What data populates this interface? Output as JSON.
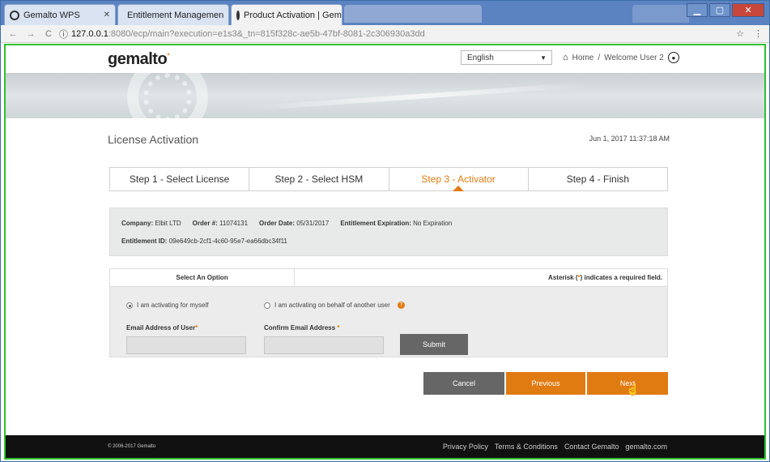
{
  "browser": {
    "tabs": [
      {
        "title": "Gemalto WPS"
      },
      {
        "title": "Entitlement Managemen"
      },
      {
        "title": "Product Activation | Gem"
      }
    ],
    "url_host": "127.0.0.1",
    "url_path": ":8080/ecp/main?execution=e1s3&_tn=815f328c-ae5b-47bf-8081-2c306930a3dd",
    "window_controls": [
      "minimize",
      "maximize",
      "close"
    ]
  },
  "header": {
    "logo": "gemalto",
    "language": "English",
    "home": "Home",
    "separator": "/",
    "welcome": "Welcome User 2"
  },
  "page": {
    "title": "License Activation",
    "datetime": "Jun 1, 2017 11:37:18 AM"
  },
  "steps": [
    {
      "label": "Step 1 - Select License"
    },
    {
      "label": "Step 2 - Select HSM"
    },
    {
      "label": "Step 3 - Activator",
      "active": true
    },
    {
      "label": "Step 4 - Finish"
    }
  ],
  "info": {
    "company_label": "Company:",
    "company": "Elbit LTD",
    "order_label": "Order #:",
    "order": "11074131",
    "order_date_label": "Order Date:",
    "order_date": "05/31/2017",
    "expiration_label": "Entitlement Expiration:",
    "expiration": "No Expiration",
    "entitlement_label": "Entitlement ID:",
    "entitlement_id": "09e649cb-2cf1-4c60-95e7-ea66dbc34f11"
  },
  "options": {
    "header_left": "Select An Option",
    "header_right_prefix": "Asterisk (",
    "header_right_star": "*",
    "header_right_suffix": ") indicates a required field.",
    "radio_self": "I am activating for myself",
    "radio_other": "I am activating on behalf of another user",
    "email_label": "Email Address of User",
    "confirm_label": "Confirm Email Address",
    "required_mark": "*",
    "submit": "Submit"
  },
  "actions": {
    "cancel": "Cancel",
    "previous": "Previous",
    "next": "Next"
  },
  "footer": {
    "copyright": "© 2006-2017 Gemalto",
    "links": [
      "Privacy Policy",
      "Terms & Conditions",
      "Contact Gemalto",
      "gemalto.com"
    ]
  },
  "colors": {
    "accent": "#e07b12",
    "dark_button": "#666666",
    "footer_bg": "#111111",
    "frame_border": "#2ec22e"
  }
}
